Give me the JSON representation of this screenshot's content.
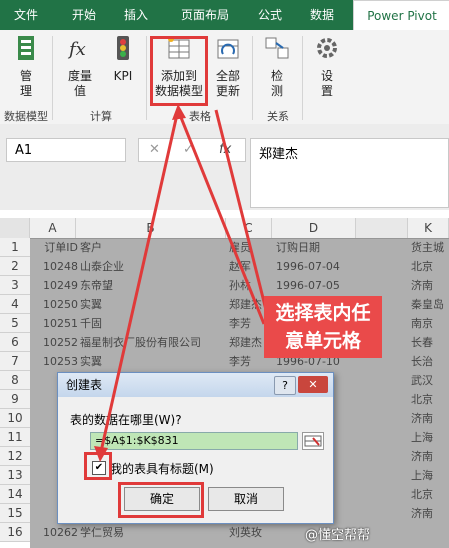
{
  "ribbon_tabs": [
    "文件",
    "开始",
    "插入",
    "页面布局",
    "公式",
    "数据",
    "Power Pivot"
  ],
  "ribbon": {
    "manage": "管\n理",
    "measures": "度量\n值",
    "kpi": "KPI",
    "add_to_model": "添加到\n数据模型",
    "refresh_all": "全部\n更新",
    "detect": "检\n测",
    "settings": "设\n置",
    "groups": [
      "数据模型",
      "计算",
      "表格",
      "关系"
    ]
  },
  "formula_bar": {
    "name_box": "A1",
    "fx": "fx",
    "value": "郑建杰"
  },
  "columns": [
    "A",
    "B",
    "C",
    "D",
    "K"
  ],
  "rows": [
    {
      "n": "1",
      "a": "订单ID",
      "b": "客户",
      "c": "雇员",
      "d": "订购日期",
      "k": "货主城"
    },
    {
      "n": "2",
      "a": "10248",
      "b": "山泰企业",
      "c": "赵军",
      "d": "1996-07-04",
      "k": "北京"
    },
    {
      "n": "3",
      "a": "10249",
      "b": "东帝望",
      "c": "孙林",
      "d": "1996-07-05",
      "k": "济南"
    },
    {
      "n": "4",
      "a": "10250",
      "b": "实翼",
      "c": "郑建杰",
      "d": "1996-07-08",
      "k": "秦皇岛"
    },
    {
      "n": "5",
      "a": "10251",
      "b": "千固",
      "c": "李芳",
      "d": "1996-07-08",
      "k": "南京"
    },
    {
      "n": "6",
      "a": "10252",
      "b": "福星制衣厂股份有限公司",
      "c": "郑建杰",
      "d": "1996-07-09",
      "k": "长春"
    },
    {
      "n": "7",
      "a": "10253",
      "b": "实翼",
      "c": "李芳",
      "d": "1996-07-10",
      "k": "长治"
    },
    {
      "n": "8",
      "a": "",
      "b": "",
      "c": "",
      "d": "",
      "k": "武汉"
    },
    {
      "n": "9",
      "a": "",
      "b": "",
      "c": "",
      "d": "",
      "k": "北京"
    },
    {
      "n": "10",
      "a": "",
      "b": "",
      "c": "",
      "d": "",
      "k": "济南"
    },
    {
      "n": "11",
      "a": "",
      "b": "",
      "c": "",
      "d": "",
      "k": "上海"
    },
    {
      "n": "12",
      "a": "",
      "b": "",
      "c": "",
      "d": "",
      "k": "济南"
    },
    {
      "n": "13",
      "a": "",
      "b": "",
      "c": "",
      "d": "",
      "k": "上海"
    },
    {
      "n": "14",
      "a": "",
      "b": "",
      "c": "",
      "d": "",
      "k": "北京"
    },
    {
      "n": "15",
      "a": "",
      "b": "",
      "c": "",
      "d": "",
      "k": "济南"
    },
    {
      "n": "16",
      "a": "10262",
      "b": "学仁贸易",
      "c": "刘英玫",
      "d": "",
      "k": ""
    }
  ],
  "dialog": {
    "title": "创建表",
    "help": "?",
    "close": "✕",
    "question": "表的数据在哪里(W)?",
    "range": "=$A$1:$K$831",
    "has_headers": "我的表具有标题(M)",
    "checkbox_mark": "✔",
    "ok": "确定",
    "cancel": "取消"
  },
  "annotation": "选择表内任\n意单元格",
  "watermark": "@懂空帮帮",
  "colors": {
    "ribbon_green": "#217346",
    "annotation_red": "#e03a3a"
  }
}
